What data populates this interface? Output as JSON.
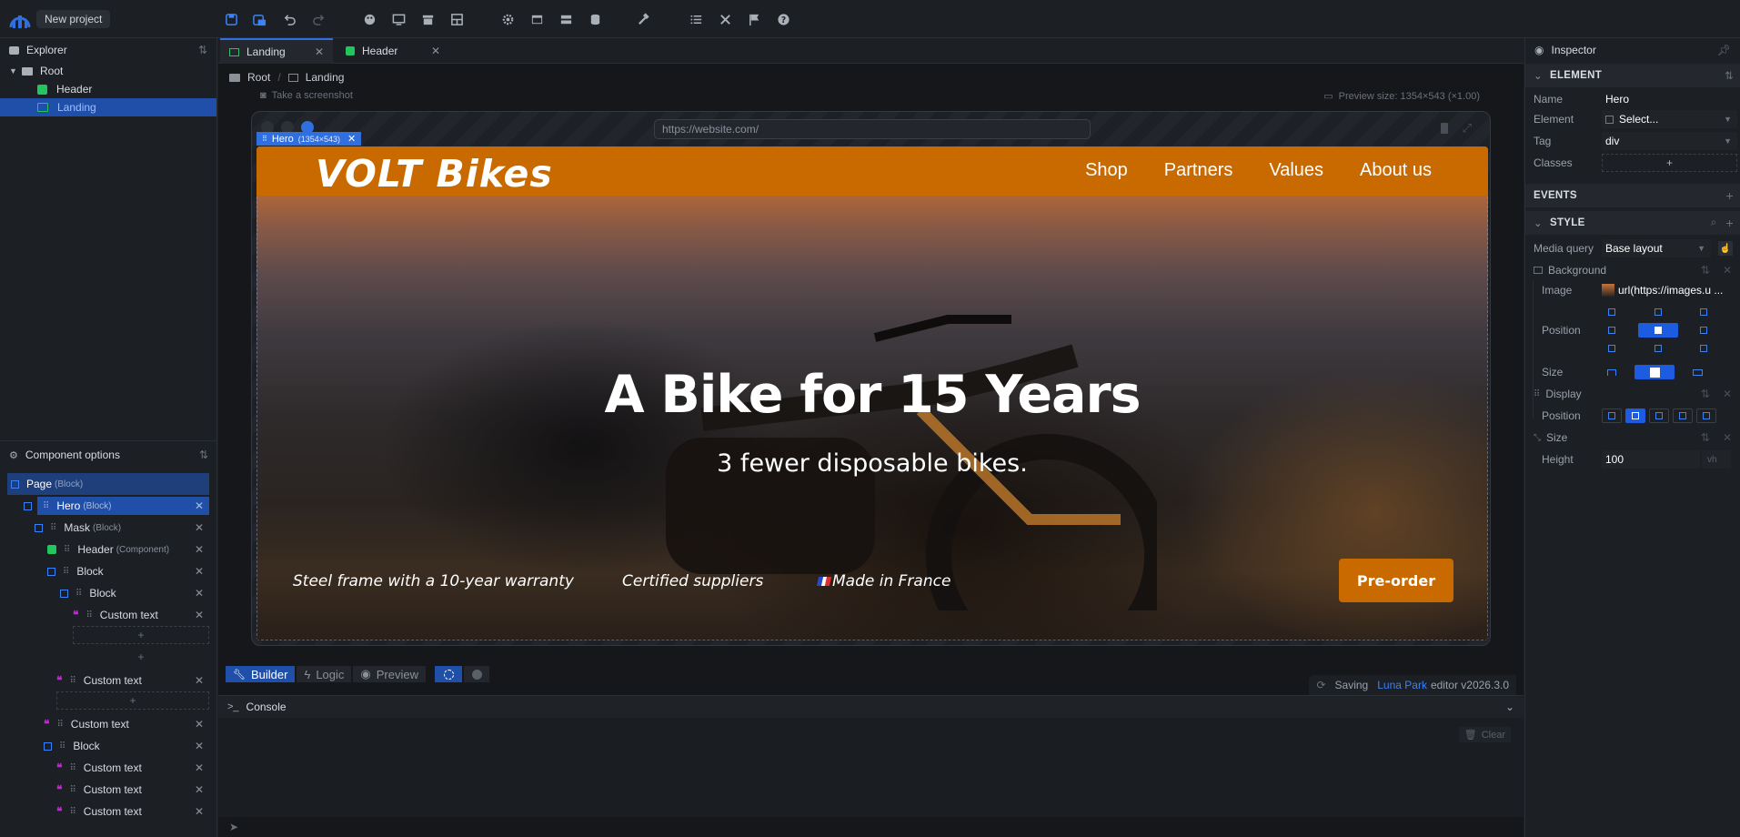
{
  "app": {
    "project_name": "New project"
  },
  "explorer": {
    "title": "Explorer",
    "tree": [
      {
        "label": "Root",
        "icon": "folder-icon"
      },
      {
        "label": "Header",
        "icon": "component-icon"
      },
      {
        "label": "Landing",
        "icon": "page-icon"
      }
    ]
  },
  "component_options": {
    "title": "Component options",
    "items": [
      {
        "label": "Page",
        "type": "(Block)"
      },
      {
        "label": "Hero",
        "type": "(Block)"
      },
      {
        "label": "Mask",
        "type": "(Block)"
      },
      {
        "label": "Header",
        "type": "(Component)"
      },
      {
        "label": "Block",
        "type": ""
      },
      {
        "label": "Block",
        "type": ""
      },
      {
        "label": "Custom text",
        "type": ""
      },
      {
        "label": "Custom text",
        "type": ""
      },
      {
        "label": "Custom text",
        "type": ""
      },
      {
        "label": "Block",
        "type": ""
      },
      {
        "label": "Custom text",
        "type": ""
      },
      {
        "label": "Custom text",
        "type": ""
      },
      {
        "label": "Custom text",
        "type": ""
      }
    ],
    "add": "+"
  },
  "tabs": [
    {
      "label": "Landing"
    },
    {
      "label": "Header"
    }
  ],
  "breadcrumb": {
    "root": "Root",
    "current": "Landing"
  },
  "toolbar2": {
    "screenshot": "Take a screenshot",
    "preview_size": "Preview size: 1354×543 (×1.00)"
  },
  "browser": {
    "url": "https://website.com/"
  },
  "selection": {
    "name": "Hero",
    "size": "(1354×543)"
  },
  "hero": {
    "brand": "VOLT Bikes",
    "nav": [
      "Shop",
      "Partners",
      "Values",
      "About us"
    ],
    "headline": "A Bike for 15 Years",
    "subheadline": "3 fewer disposable bikes.",
    "features": [
      "Steel frame with a 10-year warranty",
      "Certified suppliers",
      "Made in France"
    ],
    "cta": "Pre-order"
  },
  "modes": {
    "builder": "Builder",
    "logic": "Logic",
    "preview": "Preview"
  },
  "status": {
    "saving": "Saving",
    "brand": "Luna Park",
    "version": "editor v2026.3.0"
  },
  "console": {
    "title": "Console",
    "clear": "Clear"
  },
  "inspector": {
    "title": "Inspector",
    "element_section": "ELEMENT",
    "name_label": "Name",
    "name_value": "Hero",
    "element_label": "Element",
    "element_value": "Select...",
    "tag_label": "Tag",
    "tag_value": "div",
    "classes_label": "Classes",
    "events_section": "EVENTS",
    "style_section": "STYLE",
    "media_label": "Media query",
    "media_value": "Base layout",
    "background_label": "Background",
    "image_label": "Image",
    "image_value": "url(https://images.u ...",
    "position_label": "Position",
    "size_label": "Size",
    "display_label": "Display",
    "display_position_label": "Position",
    "size_group_label": "Size",
    "height_label": "Height",
    "height_value": "100",
    "height_unit": "vh"
  },
  "colors": {
    "accent": "#2f6fe0",
    "brand_orange": "#c96a00"
  }
}
